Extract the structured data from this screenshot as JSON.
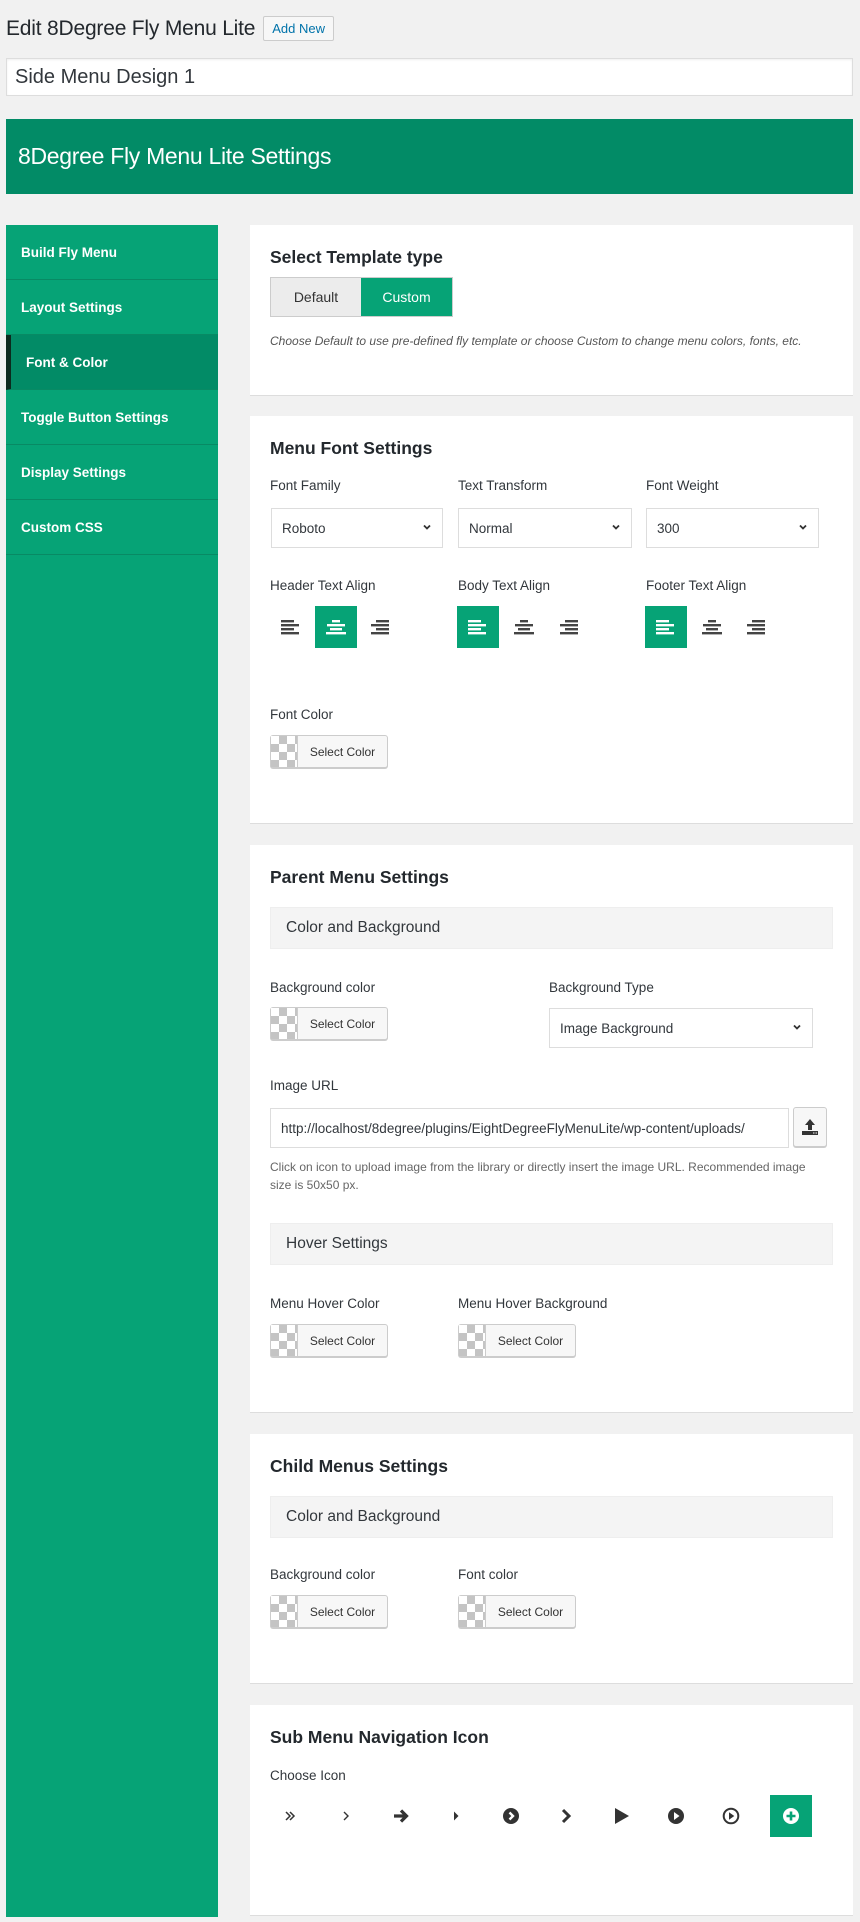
{
  "header": {
    "title": "Edit 8Degree Fly Menu Lite",
    "add_new_label": "Add New",
    "post_title_value": "Side Menu Design 1"
  },
  "banner": {
    "title": "8Degree Fly Menu Lite Settings"
  },
  "colors": {
    "accent": "#06a376",
    "accent_dark": "#028b66",
    "active_marker": "#0c2a1e"
  },
  "sidebar": {
    "items": [
      {
        "label": "Build Fly Menu",
        "active": false
      },
      {
        "label": "Layout Settings",
        "active": false
      },
      {
        "label": "Font & Color",
        "active": true
      },
      {
        "label": "Toggle Button Settings",
        "active": false
      },
      {
        "label": "Display Settings",
        "active": false
      },
      {
        "label": "Custom CSS",
        "active": false
      }
    ]
  },
  "template": {
    "title": "Select Template type",
    "options": [
      "Default",
      "Custom"
    ],
    "selected": "Custom",
    "hint": "Choose Default to use pre-defined fly template or choose Custom to change menu colors, fonts, etc."
  },
  "font_settings": {
    "title": "Menu Font Settings",
    "font_family": {
      "label": "Font Family",
      "value": "Roboto"
    },
    "text_transform": {
      "label": "Text Transform",
      "value": "Normal"
    },
    "font_weight": {
      "label": "Font Weight",
      "value": "300"
    },
    "header_align": {
      "label": "Header Text Align",
      "selected": "center"
    },
    "body_align": {
      "label": "Body Text Align",
      "selected": "left"
    },
    "footer_align": {
      "label": "Footer Text Align",
      "selected": "left"
    },
    "font_color": {
      "label": "Font Color",
      "button": "Select Color"
    }
  },
  "parent_menu": {
    "title": "Parent Menu Settings",
    "subhead_color": "Color and Background",
    "bg_color": {
      "label": "Background color",
      "button": "Select Color"
    },
    "bg_type": {
      "label": "Background Type",
      "value": "Image Background"
    },
    "image_url": {
      "label": "Image URL",
      "value": "http://localhost/8degree/plugins/EightDegreeFlyMenuLite/wp-content/uploads/",
      "help": "Click on icon to upload image from the library or directly insert the image URL. Recommended image size is 50x50 px."
    },
    "subhead_hover": "Hover Settings",
    "hover_color": {
      "label": "Menu Hover Color",
      "button": "Select Color"
    },
    "hover_bg": {
      "label": "Menu Hover Background",
      "button": "Select Color"
    }
  },
  "child_menu": {
    "title": "Child Menus Settings",
    "subhead_color": "Color and Background",
    "bg_color": {
      "label": "Background color",
      "button": "Select Color"
    },
    "font_color": {
      "label": "Font color",
      "button": "Select Color"
    }
  },
  "sub_nav": {
    "title": "Sub Menu Navigation Icon",
    "label": "Choose Icon",
    "icons": [
      "double-angle-right",
      "angle-right",
      "arrow-right",
      "caret-right",
      "chevron-circle-right",
      "chevron-right",
      "play",
      "play-circle",
      "play-circle-outline",
      "plus-circle"
    ],
    "selected": "plus-circle"
  }
}
